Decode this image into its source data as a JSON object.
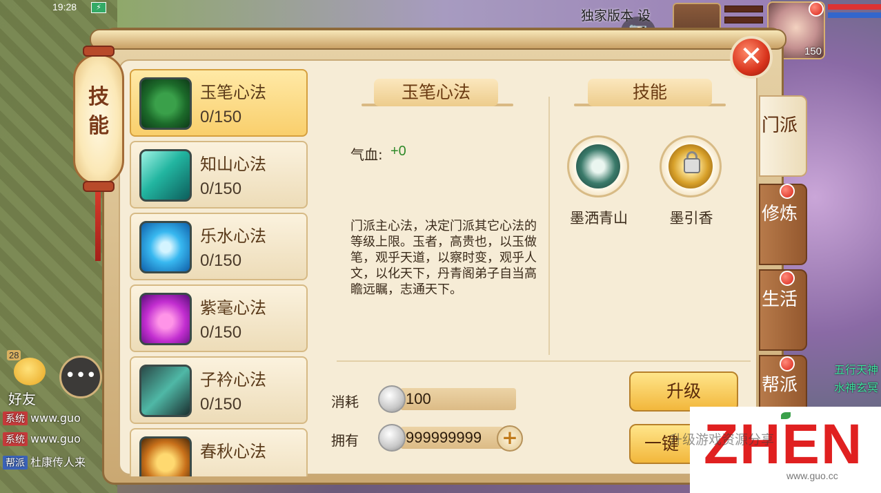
{
  "status_bar": {
    "time": "19:28",
    "battery": "⚡"
  },
  "top_right": {
    "exclusive_text": "独家版本 设",
    "camera": "📷",
    "player_level": "150"
  },
  "panel": {
    "title": "技能",
    "close": "✕"
  },
  "skills": [
    {
      "name": "玉笔心法",
      "level": "0/150",
      "icon": "jade-brush-icon"
    },
    {
      "name": "知山心法",
      "level": "0/150",
      "icon": "mountain-icon"
    },
    {
      "name": "乐水心法",
      "level": "0/150",
      "icon": "water-swirl-icon"
    },
    {
      "name": "紫毫心法",
      "level": "0/150",
      "icon": "purple-brush-icon"
    },
    {
      "name": "子衿心法",
      "level": "0/150",
      "icon": "ink-brush-icon"
    },
    {
      "name": "春秋心法",
      "level": "",
      "icon": "golden-flame-icon"
    }
  ],
  "detail": {
    "banner_title": "玉笔心法",
    "stat_label": "气血:",
    "stat_value": "+0",
    "description": "门派主心法，决定门派其它心法的等级上限。玉者，高贵也，以玉做笔，观乎天道，以察时变，观乎人文，以化天下，丹青阁弟子自当高瞻远瞩，志通天下。"
  },
  "skill_section": {
    "banner_title": "技能",
    "items": [
      {
        "name": "墨洒青山",
        "locked": false
      },
      {
        "name": "墨引香",
        "locked": true
      }
    ]
  },
  "cost": {
    "consume_label": "消耗",
    "consume_value": "100",
    "own_label": "拥有",
    "own_value": "999999999",
    "plus": "+"
  },
  "buttons": {
    "upgrade": "升级",
    "one_click": "一键"
  },
  "side_tabs": [
    {
      "label": "门派",
      "active": true
    },
    {
      "label": "修炼",
      "active": false
    },
    {
      "label": "生活",
      "active": false
    },
    {
      "label": "帮派",
      "active": false
    }
  ],
  "hud": {
    "friends_level": "28",
    "friends_label": "好友",
    "chat_icon": "•••",
    "chat": [
      {
        "tag": "系统",
        "text": "www.guo"
      },
      {
        "tag": "系统",
        "text": "www.guo"
      },
      {
        "tag": "帮派",
        "text": "杜康传人来"
      }
    ],
    "right_text_1": "五行天神",
    "right_text_2": "水神玄冥"
  },
  "watermark": {
    "brand": "ZHEN",
    "overlay": "升级游戏资源分享",
    "site": "www.guo.cc"
  },
  "colors": {
    "panel_bg": "#f6ecd6",
    "active_item": "#f9cf6c",
    "stat_positive": "#2f8a2a",
    "close_red": "#d8331c"
  }
}
